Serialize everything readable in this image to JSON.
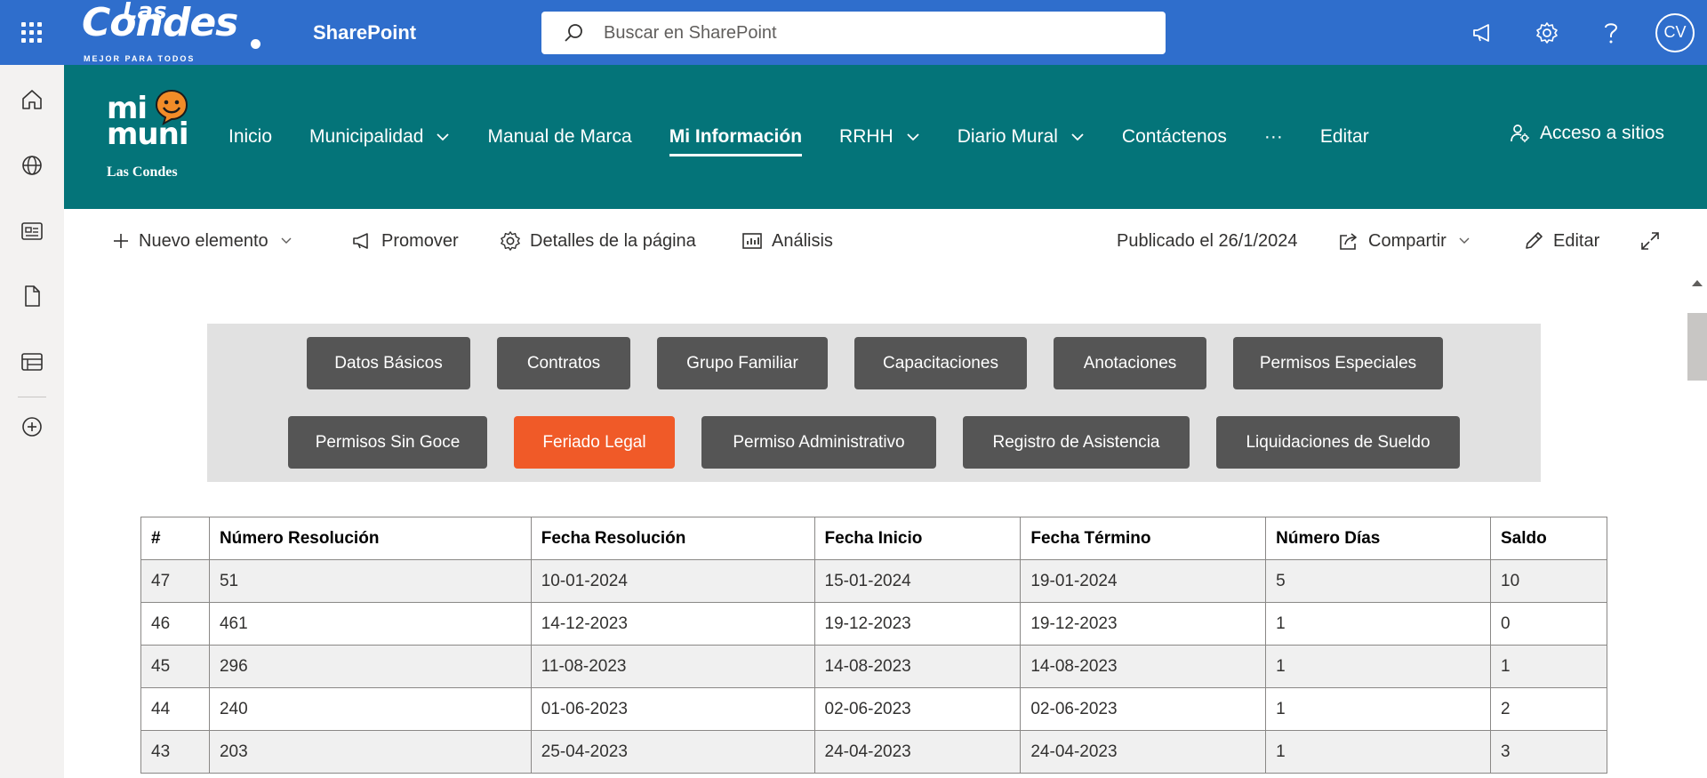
{
  "suitebar": {
    "brand_top": "Las",
    "brand_main": "Condes",
    "brand_sub": "MEJOR PARA TODOS",
    "app_name": "SharePoint",
    "search_placeholder": "Buscar en SharePoint",
    "avatar_initials": "CV"
  },
  "site": {
    "logo_line1": "mi",
    "logo_line2": "muni",
    "logo_line3": "Las Condes",
    "nav": [
      {
        "label": "Inicio",
        "dropdown": false
      },
      {
        "label": "Municipalidad",
        "dropdown": true
      },
      {
        "label": "Manual de Marca",
        "dropdown": false
      },
      {
        "label": "Mi Información",
        "dropdown": false,
        "active": true
      },
      {
        "label": "RRHH",
        "dropdown": true
      },
      {
        "label": "Diario Mural",
        "dropdown": true
      },
      {
        "label": "Contáctenos",
        "dropdown": false
      },
      {
        "label": "···",
        "dropdown": false
      },
      {
        "label": "Editar",
        "dropdown": false
      }
    ],
    "access_label": "Acceso a sitios"
  },
  "commandbar": {
    "new_item": "Nuevo elemento",
    "promote": "Promover",
    "page_details": "Detalles de la página",
    "analytics": "Análisis",
    "published": "Publicado el 26/1/2024",
    "share": "Compartir",
    "edit": "Editar"
  },
  "tabs": {
    "row1": [
      "Datos Básicos",
      "Contratos",
      "Grupo Familiar",
      "Capacitaciones",
      "Anotaciones",
      "Permisos Especiales"
    ],
    "row2": [
      "Permisos Sin Goce",
      "Feriado Legal",
      "Permiso Administrativo",
      "Registro de Asistencia",
      "Liquidaciones de Sueldo"
    ],
    "selected": "Feriado Legal",
    "selected_color": "#f05a28",
    "default_color": "#555555"
  },
  "table": {
    "headers": [
      "#",
      "Número Resolución",
      "Fecha Resolución",
      "Fecha Inicio",
      "Fecha Término",
      "Número Días",
      "Saldo"
    ],
    "rows": [
      [
        "47",
        "51",
        "10-01-2024",
        "15-01-2024",
        "19-01-2024",
        "5",
        "10"
      ],
      [
        "46",
        "461",
        "14-12-2023",
        "19-12-2023",
        "19-12-2023",
        "1",
        "0"
      ],
      [
        "45",
        "296",
        "11-08-2023",
        "14-08-2023",
        "14-08-2023",
        "1",
        "1"
      ],
      [
        "44",
        "240",
        "01-06-2023",
        "02-06-2023",
        "02-06-2023",
        "1",
        "2"
      ],
      [
        "43",
        "203",
        "25-04-2023",
        "24-04-2023",
        "24-04-2023",
        "1",
        "3"
      ]
    ]
  },
  "colors": {
    "suitebar": "#2f6ecc",
    "site_header": "#047479"
  }
}
